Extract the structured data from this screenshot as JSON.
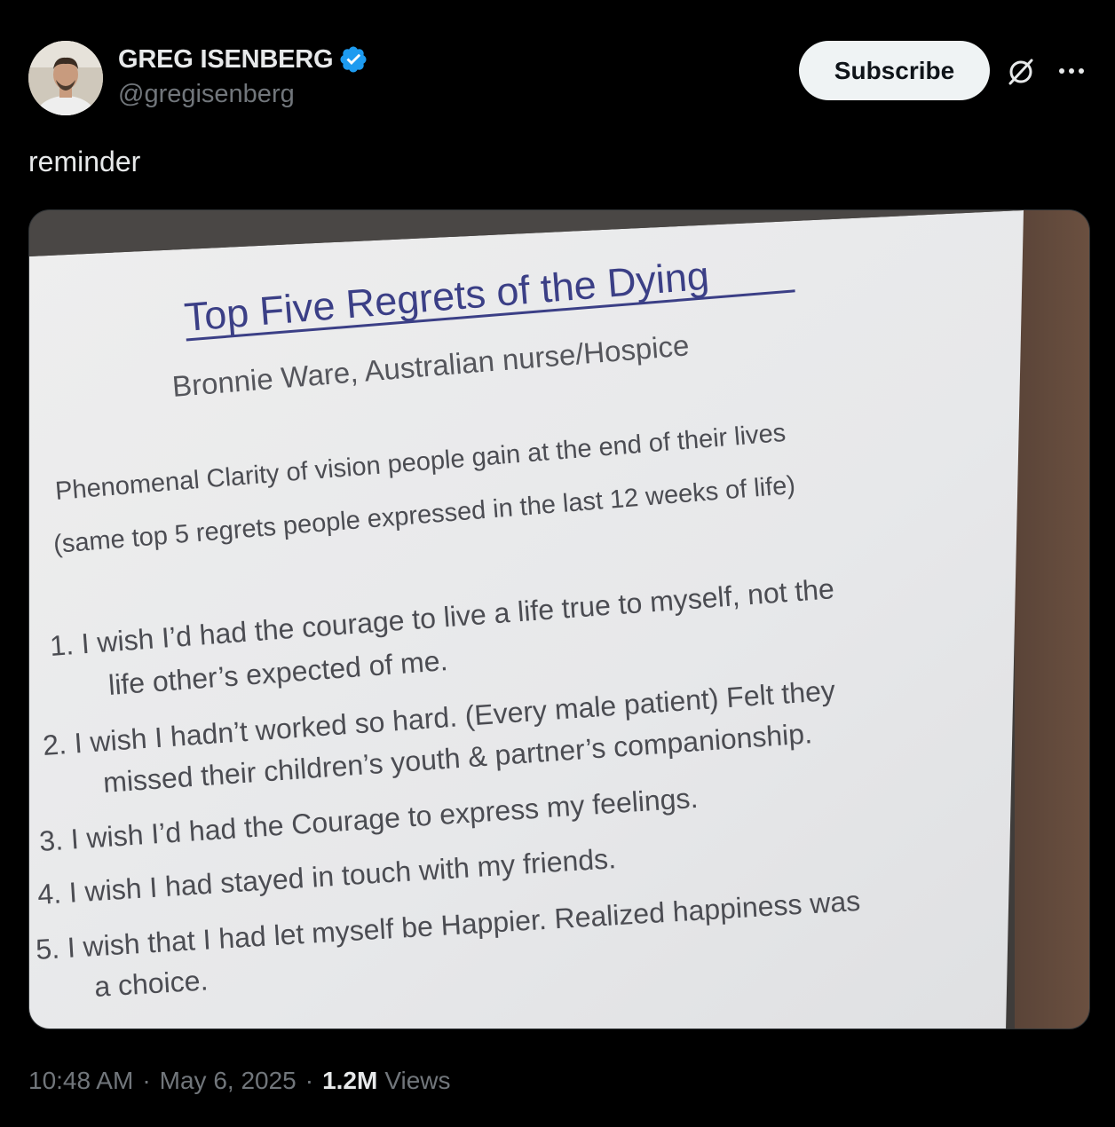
{
  "author": {
    "display_name": "GREG ISENBERG",
    "handle": "@gregisenberg",
    "verified": true
  },
  "actions": {
    "subscribe_label": "Subscribe",
    "grok_icon": "grok-icon",
    "more_icon": "more-icon"
  },
  "tweet": {
    "text": "reminder"
  },
  "image": {
    "title": "Top Five Regrets of the Dying",
    "subtitle": "Bronnie Ware, Australian nurse/Hospice",
    "intro_line1": "Phenomenal Clarity of vision people gain at the end of their lives",
    "intro_line2": "(same top 5 regrets people expressed in the last 12 weeks of life)",
    "items": [
      {
        "line1": "1. I wish I’d had the courage to live a life true to myself, not the",
        "line2": "life other’s expected of me."
      },
      {
        "line1": "2. I wish I hadn’t worked so hard. (Every male patient) Felt they",
        "line2": "missed their children’s youth & partner’s companionship."
      },
      {
        "line1": "3. I wish I’d had the Courage to express my feelings.",
        "line2": ""
      },
      {
        "line1": "4. I wish I had stayed in touch with my friends.",
        "line2": ""
      },
      {
        "line1": "5. I wish that I had let myself be Happier. Realized happiness was",
        "line2": "a choice."
      }
    ]
  },
  "meta": {
    "time": "10:48 AM",
    "separator": "·",
    "date": "May 6, 2025",
    "views_count": "1.2M",
    "views_label": "Views"
  },
  "colors": {
    "background": "#000000",
    "text_primary": "#e7e9ea",
    "text_secondary": "#71767b",
    "verified_blue": "#1d9bf0",
    "slide_title": "#3b3f86"
  }
}
